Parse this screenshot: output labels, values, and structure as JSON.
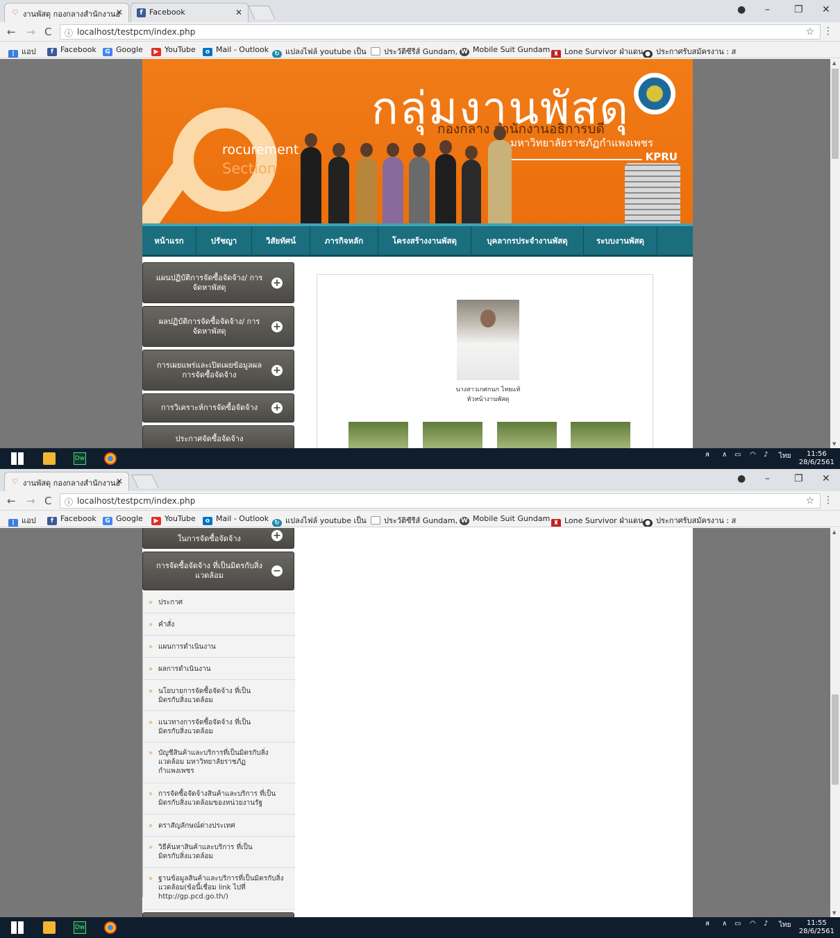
{
  "browser": {
    "tabs_top": [
      {
        "label": "งานพัสดุ กองกลางสำนักงานอ"
      },
      {
        "label": "Facebook"
      }
    ],
    "tabs_bottom": [
      {
        "label": "งานพัสดุ กองกลางสำนักงานอ"
      }
    ],
    "url": "localhost/testpcm/index.php",
    "bookmarks": [
      {
        "label": "แอป",
        "icon": "apps-grid-icon"
      },
      {
        "label": "Facebook",
        "icon": "facebook-icon"
      },
      {
        "label": "Google",
        "icon": "google-icon"
      },
      {
        "label": "YouTube",
        "icon": "youtube-icon"
      },
      {
        "label": "Mail - Outlook",
        "icon": "outlook-icon"
      },
      {
        "label": "แปลงไฟล์ youtube เป็น",
        "icon": "converter-icon"
      },
      {
        "label": "ประวัติซีรีส์ Gundam, ก",
        "icon": "page-icon"
      },
      {
        "label": "Mobile Suit Gundam",
        "icon": "wordpress-icon"
      },
      {
        "label": "Lone Survivor ฝ่าแดน",
        "icon": "movie-icon"
      },
      {
        "label": "ประกาศรับสมัครงาน : ส",
        "icon": "jobs-icon"
      }
    ]
  },
  "banner": {
    "title": "กลุ่มงานพัสดุ",
    "subtitle1": "กองกลาง สำนักงานอธิการบดี",
    "subtitle2": "มหาวิทยาลัยราชภัฏกำแพงเพชร",
    "kpru": "KPRU",
    "procurement": "rocurement",
    "section": "Section"
  },
  "nav": [
    "หน้าแรก",
    "ปรัชญา",
    "วิสัยทัศน์",
    "ภารกิจหลัก",
    "โครงสร้างงานพัสดุ",
    "บุคลากรประจำงานพัสดุ",
    "ระบบงานพัสดุ"
  ],
  "sidebar_top": [
    "แผนปฏิบัติการจัดซื้อจัดจ้าง/ การจัดหาพัสดุ",
    "ผลปฏิบัติการจัดซื้อจัดจ้าง/ การจัดหาพัสดุ",
    "การเผยแพร่และเปิดเผยข้อมูลผล การจัดซื้อจัดจ้าง",
    "การวิเคราะห์การจัดซื้อจัดจ้าง",
    "ประกาศจัดซื้อจัดจ้าง"
  ],
  "sidebar_bottom": {
    "partial": "ในการจัดซื้อจัดจ้าง",
    "expanded": "การจัดซื้อจัดจ้าง ที่เป็นมิตรกับสิ่งแวดล้อม",
    "items": [
      "ประกาศ",
      "คำสั่ง",
      "แผนการดำเนินงาน",
      "ผลการดำเนินงาน",
      "นโยบายการจัดซื้อจัดจ้าง ที่เป็นมิตรกับสิ่งแวดล้อม",
      "แนวทางการจัดซื้อจัดจ้าง ที่เป็นมิตรกับสิ่งแวดล้อม",
      "บัญชีสินค้าและบริการที่เป็นมิตรกับสิ่ง แวดล้อม มหาวิทยาลัยราชภัฏกำแพงเพชร",
      "การจัดซื้อจัดจ้างสินค้าและบริการ ที่เป็นมิตรกับสิ่งแวดล้อมของหน่วยงานรัฐ",
      "ตราสัญลักษณ์ต่างประเทศ",
      "วิธีค้นหาสินค้าและบริการ ที่เป็นมิตรกับสิ่งแวดล้อม",
      "ฐานข้อมูลสินค้าและบริการที่เป็นมิตรกับสิ่ง แวดล้อม(ข้อนี้เชื่อม link ไปที่ http://gp.pcd.go.th/)"
    ]
  },
  "staff": {
    "name": "นางสาวเกศกนก ไทยแท้",
    "position": "หัวหน้างานพัสดุ"
  },
  "taskbar": {
    "lang": "ไทย",
    "time_top": "11:56",
    "date_top": "28/6/2561",
    "time_bottom": "11:55",
    "date_bottom": "28/6/2561"
  },
  "colors": {
    "banner_orange": "#ee7311",
    "nav_teal": "#1a6e7e",
    "sidebar_gray": "#55534e"
  }
}
